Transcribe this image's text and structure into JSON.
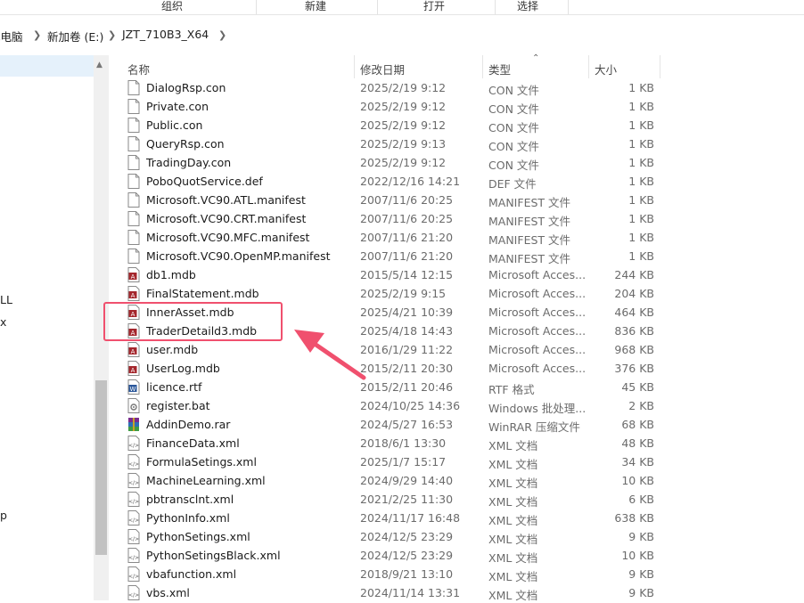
{
  "ribbon": {
    "groups": [
      "组织",
      "新建",
      "打开",
      "选择"
    ]
  },
  "address": {
    "parts": [
      "此电脑",
      "新加卷 (E:)",
      "JZT_710B3_X64"
    ]
  },
  "nav": {
    "cut_labels": [
      "LL",
      "x",
      "p"
    ]
  },
  "columns": {
    "name": "名称",
    "date": "修改日期",
    "type": "类型",
    "size": "大小"
  },
  "files": [
    {
      "name": "DialogRsp.con",
      "date": "2025/2/19 9:12",
      "type": "CON 文件",
      "size": "1 KB",
      "icon": "generic-file-icon"
    },
    {
      "name": "Private.con",
      "date": "2025/2/19 9:12",
      "type": "CON 文件",
      "size": "1 KB",
      "icon": "generic-file-icon"
    },
    {
      "name": "Public.con",
      "date": "2025/2/19 9:12",
      "type": "CON 文件",
      "size": "1 KB",
      "icon": "generic-file-icon"
    },
    {
      "name": "QueryRsp.con",
      "date": "2025/2/19 9:13",
      "type": "CON 文件",
      "size": "1 KB",
      "icon": "generic-file-icon"
    },
    {
      "name": "TradingDay.con",
      "date": "2025/2/19 9:12",
      "type": "CON 文件",
      "size": "1 KB",
      "icon": "generic-file-icon"
    },
    {
      "name": "PoboQuotService.def",
      "date": "2022/12/16 14:21",
      "type": "DEF 文件",
      "size": "1 KB",
      "icon": "generic-file-icon"
    },
    {
      "name": "Microsoft.VC90.ATL.manifest",
      "date": "2007/11/6 20:25",
      "type": "MANIFEST 文件",
      "size": "1 KB",
      "icon": "generic-file-icon"
    },
    {
      "name": "Microsoft.VC90.CRT.manifest",
      "date": "2007/11/6 20:25",
      "type": "MANIFEST 文件",
      "size": "1 KB",
      "icon": "generic-file-icon"
    },
    {
      "name": "Microsoft.VC90.MFC.manifest",
      "date": "2007/11/6 21:20",
      "type": "MANIFEST 文件",
      "size": "1 KB",
      "icon": "generic-file-icon"
    },
    {
      "name": "Microsoft.VC90.OpenMP.manifest",
      "date": "2007/11/6 21:20",
      "type": "MANIFEST 文件",
      "size": "1 KB",
      "icon": "generic-file-icon"
    },
    {
      "name": "db1.mdb",
      "date": "2015/5/14 12:15",
      "type": "Microsoft Acces...",
      "size": "244 KB",
      "icon": "access-db-icon"
    },
    {
      "name": "FinalStatement.mdb",
      "date": "2025/2/19 9:15",
      "type": "Microsoft Acces...",
      "size": "204 KB",
      "icon": "access-db-icon"
    },
    {
      "name": "InnerAsset.mdb",
      "date": "2025/4/21 10:39",
      "type": "Microsoft Acces...",
      "size": "464 KB",
      "icon": "access-db-icon"
    },
    {
      "name": "TraderDetaild3.mdb",
      "date": "2025/4/18 14:43",
      "type": "Microsoft Acces...",
      "size": "836 KB",
      "icon": "access-db-icon"
    },
    {
      "name": "user.mdb",
      "date": "2016/1/29 11:22",
      "type": "Microsoft Acces...",
      "size": "968 KB",
      "icon": "access-db-icon"
    },
    {
      "name": "UserLog.mdb",
      "date": "2015/2/11 20:30",
      "type": "Microsoft Acces...",
      "size": "376 KB",
      "icon": "access-db-icon"
    },
    {
      "name": "licence.rtf",
      "date": "2015/2/11 20:46",
      "type": "RTF 格式",
      "size": "45 KB",
      "icon": "word-doc-icon"
    },
    {
      "name": "register.bat",
      "date": "2024/10/25 14:36",
      "type": "Windows 批处理...",
      "size": "2 KB",
      "icon": "batch-file-icon"
    },
    {
      "name": "AddinDemo.rar",
      "date": "2024/5/27 16:53",
      "type": "WinRAR 压缩文件",
      "size": "68 KB",
      "icon": "rar-archive-icon"
    },
    {
      "name": "FinanceData.xml",
      "date": "2018/6/1 13:30",
      "type": "XML 文档",
      "size": "48 KB",
      "icon": "xml-file-icon"
    },
    {
      "name": "FormulaSetings.xml",
      "date": "2025/1/7 15:17",
      "type": "XML 文档",
      "size": "34 KB",
      "icon": "xml-file-icon"
    },
    {
      "name": "MachineLearning.xml",
      "date": "2024/9/29 14:40",
      "type": "XML 文档",
      "size": "10 KB",
      "icon": "xml-file-icon"
    },
    {
      "name": "pbtransclnt.xml",
      "date": "2021/2/25 11:30",
      "type": "XML 文档",
      "size": "6 KB",
      "icon": "xml-file-icon"
    },
    {
      "name": "PythonInfo.xml",
      "date": "2024/11/17 16:48",
      "type": "XML 文档",
      "size": "638 KB",
      "icon": "xml-file-icon"
    },
    {
      "name": "PythonSetings.xml",
      "date": "2024/12/5 23:29",
      "type": "XML 文档",
      "size": "9 KB",
      "icon": "xml-file-icon"
    },
    {
      "name": "PythonSetingsBlack.xml",
      "date": "2024/12/5 23:29",
      "type": "XML 文档",
      "size": "10 KB",
      "icon": "xml-file-icon"
    },
    {
      "name": "vbafunction.xml",
      "date": "2018/9/21 13:10",
      "type": "XML 文档",
      "size": "9 KB",
      "icon": "xml-file-icon"
    },
    {
      "name": "vbs.xml",
      "date": "2024/11/14 13:31",
      "type": "XML 文档",
      "size": "9 KB",
      "icon": "xml-file-icon"
    }
  ],
  "colors": {
    "highlight": "#f0506e",
    "nav_selected": "#e5f1fb"
  }
}
